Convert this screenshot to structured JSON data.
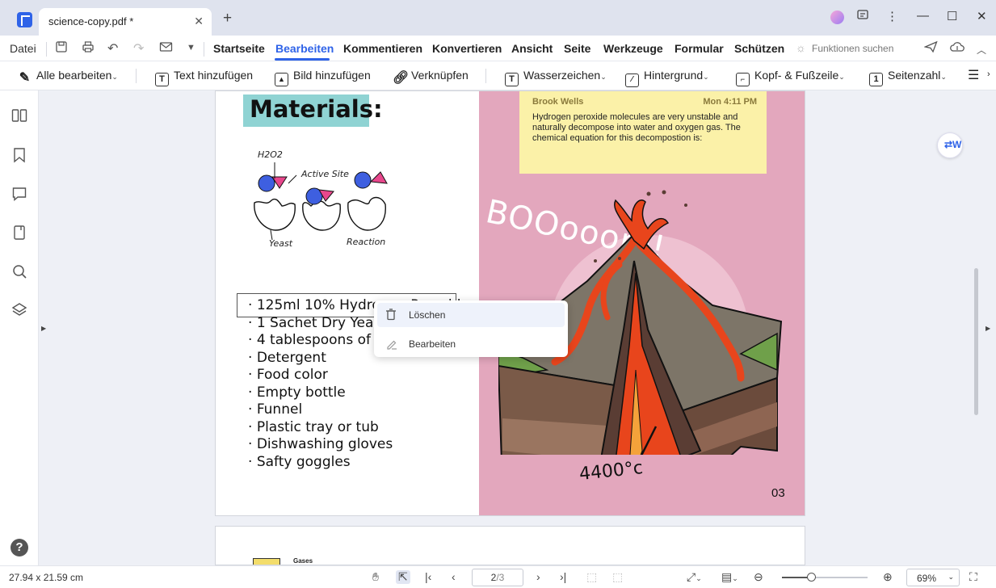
{
  "tab": {
    "title": "science-copy.pdf *",
    "close": "✕",
    "new": "+"
  },
  "window": {
    "feedback_icon": "feedback-icon",
    "more_icon": "more-icon",
    "minimize": "—",
    "maximize": "☐",
    "close": "✕"
  },
  "menu": {
    "file": "Datei",
    "items": [
      "Startseite",
      "Bearbeiten",
      "Kommentieren",
      "Konvertieren",
      "Ansicht",
      "Seite",
      "Werkzeuge",
      "Formular",
      "Schützen"
    ],
    "active": "Bearbeiten",
    "search_hint": "Funktionen suchen"
  },
  "toolbar": {
    "edit_all": "Alle bearbeiten",
    "add_text": "Text hinzufügen",
    "add_image": "Bild hinzufügen",
    "link": "Verknüpfen",
    "watermark": "Wasserzeichen",
    "background": "Hintergrund",
    "header_footer": "Kopf- & Fußzeile",
    "page_number": "Seitenzahl"
  },
  "document": {
    "materials_title": "Materials:",
    "sketch": {
      "h2o2": "H2O2",
      "active_site": "Active Site",
      "yeast": "Yeast",
      "reaction": "Reaction"
    },
    "materials": [
      "125ml 10% Hydrogen Peroxide",
      "1 Sachet Dry Yeast",
      "4 tablespoons of w",
      "Detergent",
      "Food color",
      "Empty bottle",
      "Funnel",
      "Plastic tray or tub",
      "Dishwashing gloves",
      "Safty goggles"
    ],
    "note": {
      "author": "Brook Wells",
      "time": "Mon 4:11 PM",
      "body": "Hydrogen peroxide molecules are very unstable and naturally decompose into water and oxygen gas. The chemical equation for this decompostion is:"
    },
    "boom": "BOOooom!",
    "temperature": "4400°c",
    "page_number": "03",
    "page2_label": "Gases"
  },
  "context_menu": {
    "delete": "Löschen",
    "edit": "Bearbeiten"
  },
  "status": {
    "dimensions": "27.94 x 21.59 cm",
    "current_page": "2",
    "total_pages": "/3",
    "zoom": "69%",
    "zoom_level": 0.35
  },
  "colors": {
    "accent": "#2f63e8",
    "pink_panel": "#e3a7bd",
    "note_bg": "#fbf1a8",
    "materials_bg": "#8fd3d3",
    "lava": "#e8451c"
  }
}
